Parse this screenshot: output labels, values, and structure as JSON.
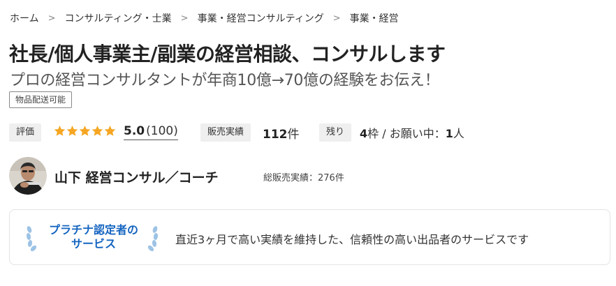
{
  "breadcrumb": {
    "items": [
      "ホーム",
      "コンサルティング・士業",
      "事業・経営コンサルティング",
      "事業・経営"
    ],
    "separator": ">"
  },
  "service": {
    "title": "社長/個人事業主/副業の経営相談、コンサルします",
    "subtitle": "プロの経営コンサルタントが年商10億→70億の経験をお伝え！",
    "shipping_tag": "物品配送可能"
  },
  "stats": {
    "rating_label": "評価",
    "stars": 5,
    "star_color": "#f5a623",
    "rating_value": "5.0",
    "rating_count": "(100)",
    "sales_label": "販売実績",
    "sales_value": "112",
    "sales_unit": "件",
    "remain_label": "残り",
    "remain_value": "4",
    "remain_unit": "枠 / お願い中：",
    "requests_value": "1",
    "requests_unit": "人"
  },
  "seller": {
    "name": "山下 経営コンサル／コーチ",
    "total_sales": "総販売実績：276件"
  },
  "platinum": {
    "badge_line1": "プラチナ認定者の",
    "badge_line2": "サービス",
    "badge_color": "#1565c0",
    "description": "直近3ヶ月で高い実績を維持した、信頼性の高い出品者のサービスです"
  }
}
